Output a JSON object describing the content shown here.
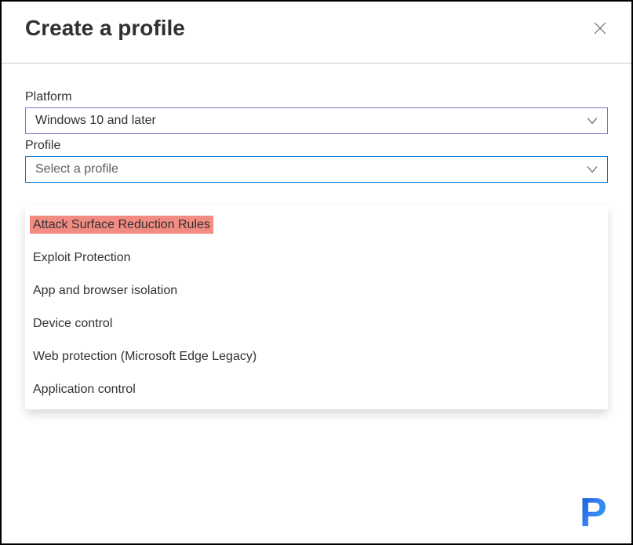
{
  "header": {
    "title": "Create a profile"
  },
  "platform": {
    "label": "Platform",
    "value": "Windows 10 and later"
  },
  "profile": {
    "label": "Profile",
    "placeholder": "Select a profile",
    "options": [
      {
        "label": "Attack Surface Reduction Rules",
        "highlighted": true
      },
      {
        "label": "Exploit Protection",
        "highlighted": false
      },
      {
        "label": "App and browser isolation",
        "highlighted": false
      },
      {
        "label": "Device control",
        "highlighted": false
      },
      {
        "label": "Web protection (Microsoft Edge Legacy)",
        "highlighted": false
      },
      {
        "label": "Application control",
        "highlighted": false
      }
    ]
  },
  "logo": {
    "letter": "P"
  }
}
